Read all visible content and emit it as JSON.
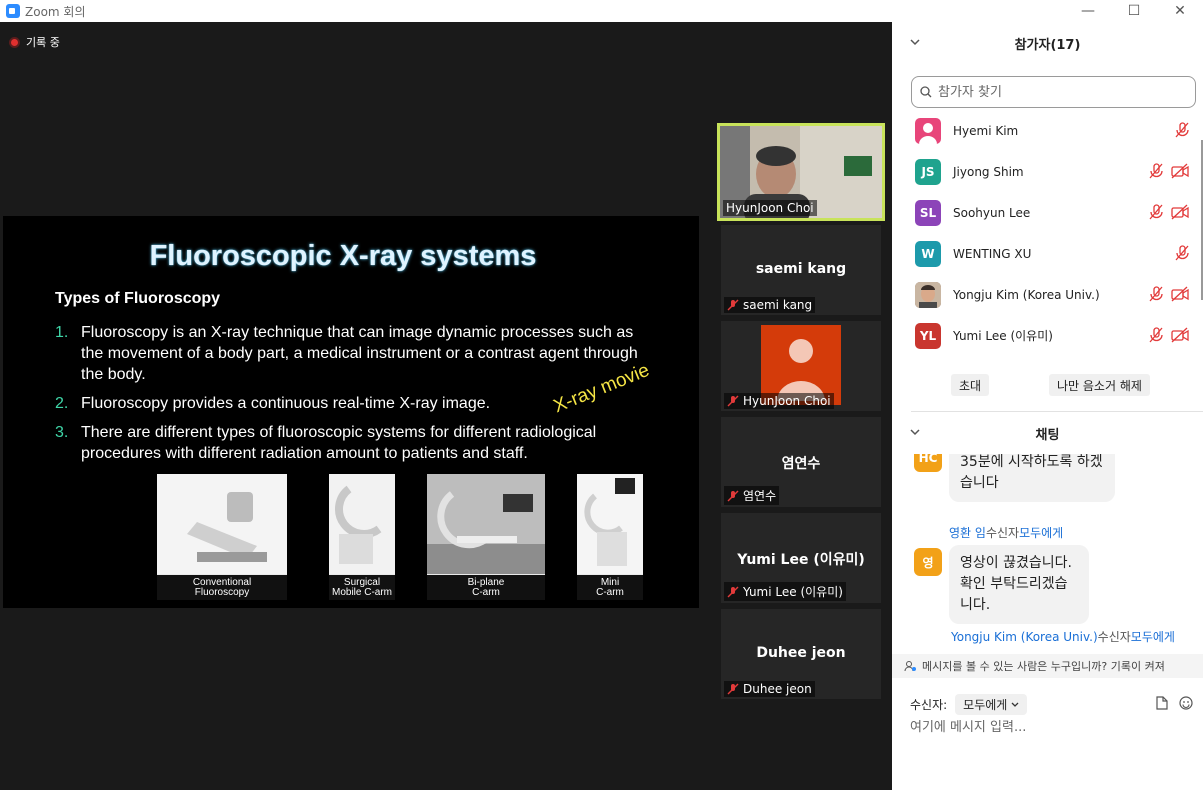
{
  "window": {
    "title": "Zoom 회의"
  },
  "recording": {
    "label": "기록 중"
  },
  "slide": {
    "title": "Fluoroscopic X-ray systems",
    "subtitle": "Types of Fluoroscopy",
    "items": [
      {
        "num": "1.",
        "text": "Fluoroscopy is an X-ray technique that can image dynamic processes such as the movement of a body part, a medical instrument or a contrast agent through the body."
      },
      {
        "num": "2.",
        "text": "Fluoroscopy provides a continuous real-time X-ray image."
      },
      {
        "num": "3.",
        "text": "There are different types of fluoroscopic systems for different radiological procedures with different radiation amount to patients and staff."
      }
    ],
    "annotation": "X-ray movie",
    "thumbnails": [
      {
        "caption1": "Conventional",
        "caption2": "Fluoroscopy"
      },
      {
        "caption1": "Surgical",
        "caption2": "Mobile C-arm"
      },
      {
        "caption1": "Bi-plane",
        "caption2": "C-arm"
      },
      {
        "caption1": "Mini",
        "caption2": "C-arm"
      }
    ]
  },
  "video_tiles": [
    {
      "name": "HyunJoon Choi",
      "center": "",
      "active": true
    },
    {
      "name": "saemi kang",
      "center": "saemi kang"
    },
    {
      "name": "HyunJoon Choi",
      "center": ""
    },
    {
      "name": "염연수",
      "center": "염연수"
    },
    {
      "name": "Yumi Lee (이유미)",
      "center": "Yumi Lee (이유미)"
    },
    {
      "name": "Duhee jeon",
      "center": "Duhee jeon"
    }
  ],
  "participants": {
    "header": "참가자(17)",
    "search_placeholder": "참가자 찾기",
    "list": [
      {
        "initials": "",
        "name": "Hyemi Kim",
        "color": "#e8457a"
      },
      {
        "initials": "JS",
        "name": "Jiyong Shim",
        "color": "#1fa38e"
      },
      {
        "initials": "SL",
        "name": "Soohyun Lee",
        "color": "#8c44b8"
      },
      {
        "initials": "W",
        "name": "WENTING  XU",
        "color": "#1d9aab"
      },
      {
        "initials": "",
        "name": "Yongju Kim (Korea Univ.)",
        "color": "#8a6a55"
      },
      {
        "initials": "YL",
        "name": "Yumi Lee (이유미)",
        "color": "#c9362f"
      }
    ],
    "invite_label": "초대",
    "unmute_label": "나만 음소거 해제"
  },
  "chat": {
    "header": "채팅",
    "msg1": "35분에 시작하도록 하겠습니다",
    "msg1_avatar": "HC",
    "sender2": "영환 임",
    "to_label": "수신자",
    "to_all": "모두에게",
    "msg2_avatar": "영",
    "msg2": "영상이 끊겼습니다. 확인 부탁드리겠습니다.",
    "sender3": "Yongju Kim (Korea Univ.)",
    "notice": "메시지를 볼 수 있는 사람은 누구입니까? 기록이 켜져",
    "recipient_label": "수신자:",
    "recipient_value": "모두에게",
    "input_placeholder": "여기에 메시지 입력..."
  }
}
